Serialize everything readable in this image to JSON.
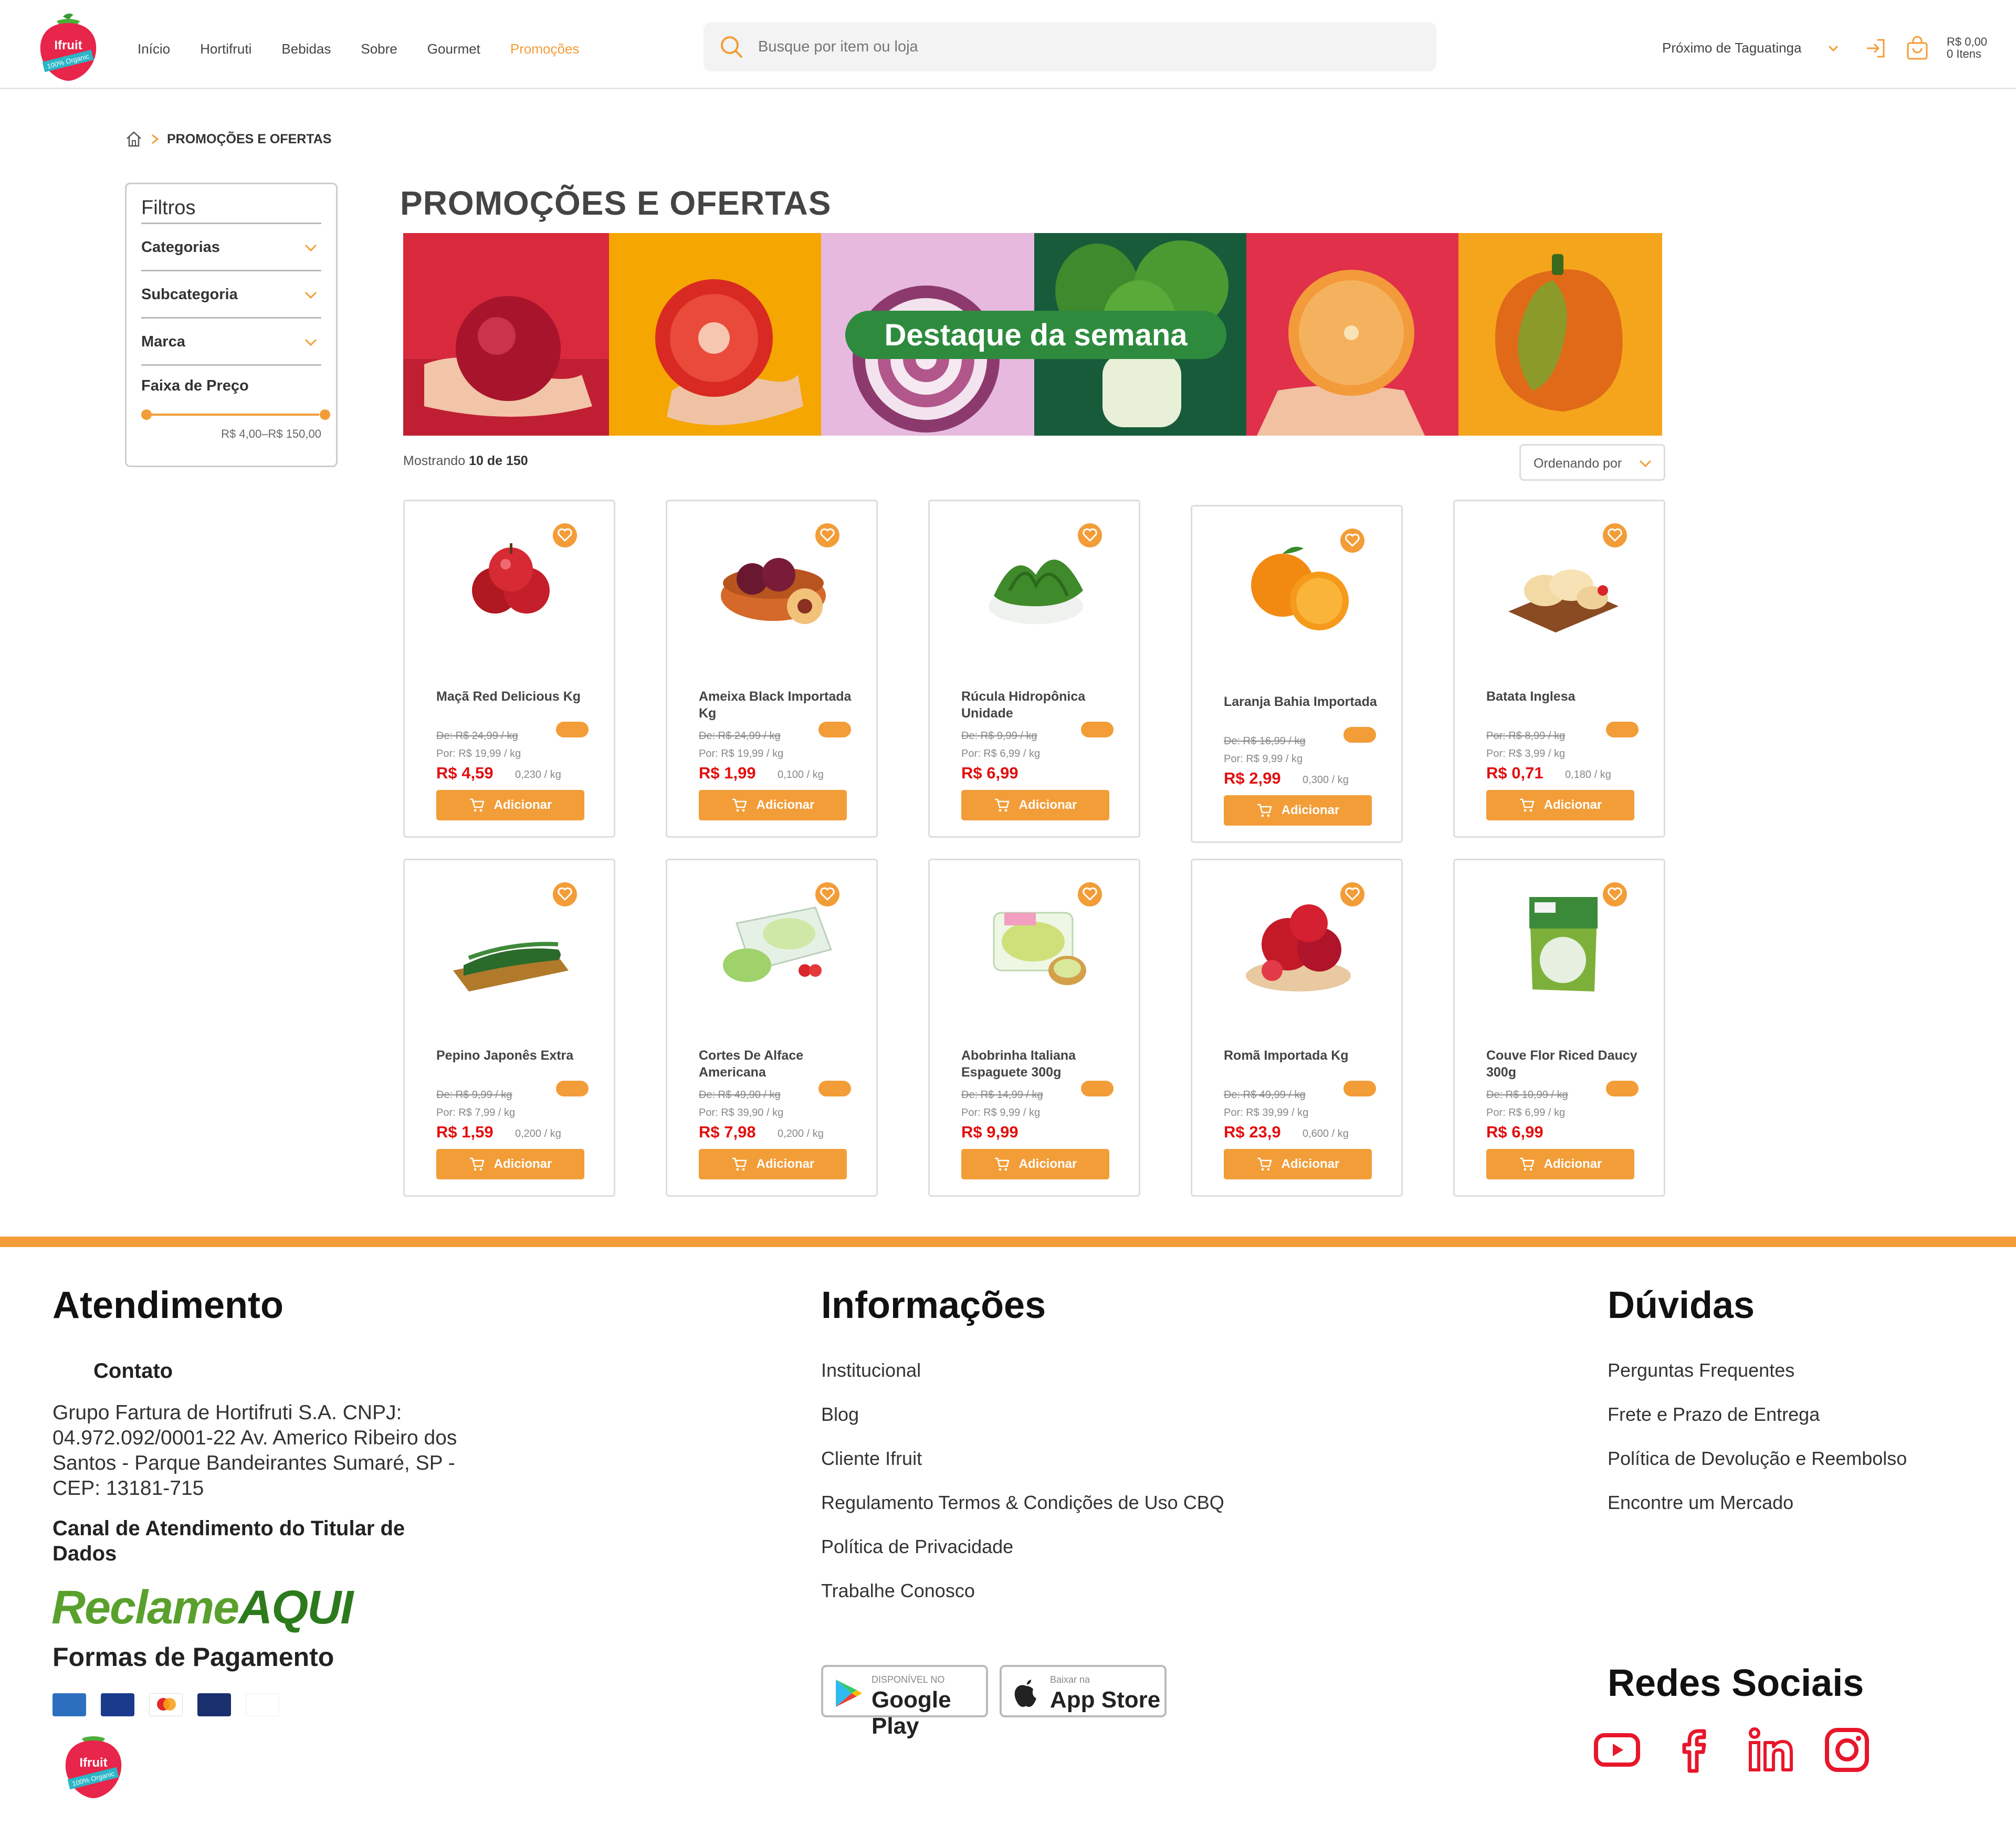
{
  "header": {
    "logo_text": "Ifruit",
    "logo_sub": "100% Organic",
    "nav": [
      "Início",
      "Hortifruti",
      "Bebidas",
      "Sobre",
      "Gourmet",
      "Promoções"
    ],
    "active_nav": "Promoções",
    "search_placeholder": "Busque por item ou loja",
    "location": "Próximo de Taguatinga",
    "cart_total": "R$ 0,00",
    "cart_items": "0 Itens"
  },
  "breadcrumb": {
    "current": "PROMOÇÕES E OFERTAS"
  },
  "filters": {
    "title": "Filtros",
    "rows": [
      "Categorias",
      "Subcategoria",
      "Marca"
    ],
    "price_title": "Faixa de Preço",
    "price_range": "R$ 4,00–R$ 150,00",
    "price_min_fraction": 0.0,
    "price_max_fraction": 1.0
  },
  "main": {
    "title": "PROMOÇÕES E OFERTAS",
    "banner_text": "Destaque da semana",
    "showing_prefix": "Mostrando ",
    "showing_count": "10 de 150",
    "sort_label": "Ordenando por"
  },
  "products": [
    {
      "name": "Maçã Red Delicious Kg",
      "old": "De: R$ 24,99 / kg",
      "por": "Por: R$ 19,99 / kg",
      "price": "R$ 4,59",
      "unit": "0,230 / kg",
      "button": "Adicionar",
      "icon": "apple-image"
    },
    {
      "name": "Ameixa Black Importada Kg",
      "old": "De: R$ 24,99 / kg",
      "por": "Por: R$ 19,99 / kg",
      "price": "R$ 1,99",
      "unit": "0,100 / kg",
      "button": "Adicionar",
      "icon": "plum-image"
    },
    {
      "name": "Rúcula Hidropônica Unidade",
      "old": "De: R$ 9,99 / kg",
      "por": "Por: R$ 6,99 / kg",
      "price": "R$ 6,99",
      "unit": "",
      "button": "Adicionar",
      "icon": "arugula-image"
    },
    {
      "name": "Laranja Bahia Importada",
      "old": "De: R$ 16,99 / kg",
      "por": "Por: R$ 9,99 / kg",
      "price": "R$ 2,99",
      "unit": "0,300 / kg",
      "button": "Adicionar",
      "icon": "orange-image"
    },
    {
      "name": "Batata Inglesa",
      "old": "Por: R$ 8,99 / kg",
      "por": "Por: R$ 3,99 / kg",
      "price": "R$ 0,71",
      "unit": "0,180 / kg",
      "button": "Adicionar",
      "icon": "potato-image"
    },
    {
      "name": "Pepino Japonês Extra",
      "old": "De: R$ 9,99 / kg",
      "por": "Por: R$ 7,99 / kg",
      "price": "R$ 1,59",
      "unit": "0,200 / kg",
      "button": "Adicionar",
      "icon": "cucumber-image"
    },
    {
      "name": "Cortes De Alface Americana",
      "old": "De: R$ 49,90 / kg",
      "por": "Por: R$ 39,90 / kg",
      "price": "R$ 7,98",
      "unit": "0,200 / kg",
      "button": "Adicionar",
      "icon": "lettuce-image"
    },
    {
      "name": "Abobrinha Italiana Espaguete 300g",
      "old": "De: R$ 14,99 / kg",
      "por": "Por: R$ 9,99 / kg",
      "price": "R$ 9,99",
      "unit": "",
      "button": "Adicionar",
      "icon": "zucchini-image"
    },
    {
      "name": "Romã Importada Kg",
      "old": "De: R$ 49,99 / kg",
      "por": "Por: R$ 39,99 / kg",
      "price": "R$ 23,9",
      "unit": "0,600 / kg",
      "button": "Adicionar",
      "icon": "pomegranate-image"
    },
    {
      "name": "Couve Flor Riced Daucy 300g",
      "old": "De: R$ 10,99 / kg",
      "por": "Por: R$ 6,99 / kg",
      "price": "R$ 6,99",
      "unit": "",
      "button": "Adicionar",
      "icon": "cauliflower-image"
    }
  ],
  "footer": {
    "atendimento": "Atendimento",
    "contato": "Contato",
    "address": "Grupo Fartura de Hortifruti S.A. CNPJ: 04.972.092/0001-22 Av. Americo Ribeiro dos Santos - Parque Bandeirantes Sumaré, SP - CEP: 13181-715",
    "canal": "Canal de Atendimento do Titular de Dados",
    "reclame_a": "Reclame",
    "reclame_b": "AQUI",
    "formas": "Formas de Pagamento",
    "informacoes": "Informações",
    "info_links": [
      "Institucional",
      "Blog",
      "Cliente Ifruit",
      "Regulamento Termos & Condições de Uso CBQ",
      "Política de Privacidade",
      "Trabalhe Conosco"
    ],
    "duvidas": "Dúvidas",
    "duvidas_links": [
      "Perguntas Frequentes",
      "Frete e Prazo de Entrega",
      "Política de Devolução e Reembolso",
      "Encontre um Mercado"
    ],
    "gplay_small": "DISPONÍVEL NO",
    "gplay_big": "Google Play",
    "appstore_small": "Baixar na",
    "appstore_big": "App Store",
    "redes": "Redes Sociais",
    "social_icons": [
      "youtube-icon",
      "facebook-icon",
      "linkedin-icon",
      "instagram-icon"
    ]
  },
  "colors": {
    "accent": "#f29d38",
    "price_red": "#e20f0f",
    "logo_red": "#e8254a",
    "banner_green": "#2e8b3e"
  }
}
